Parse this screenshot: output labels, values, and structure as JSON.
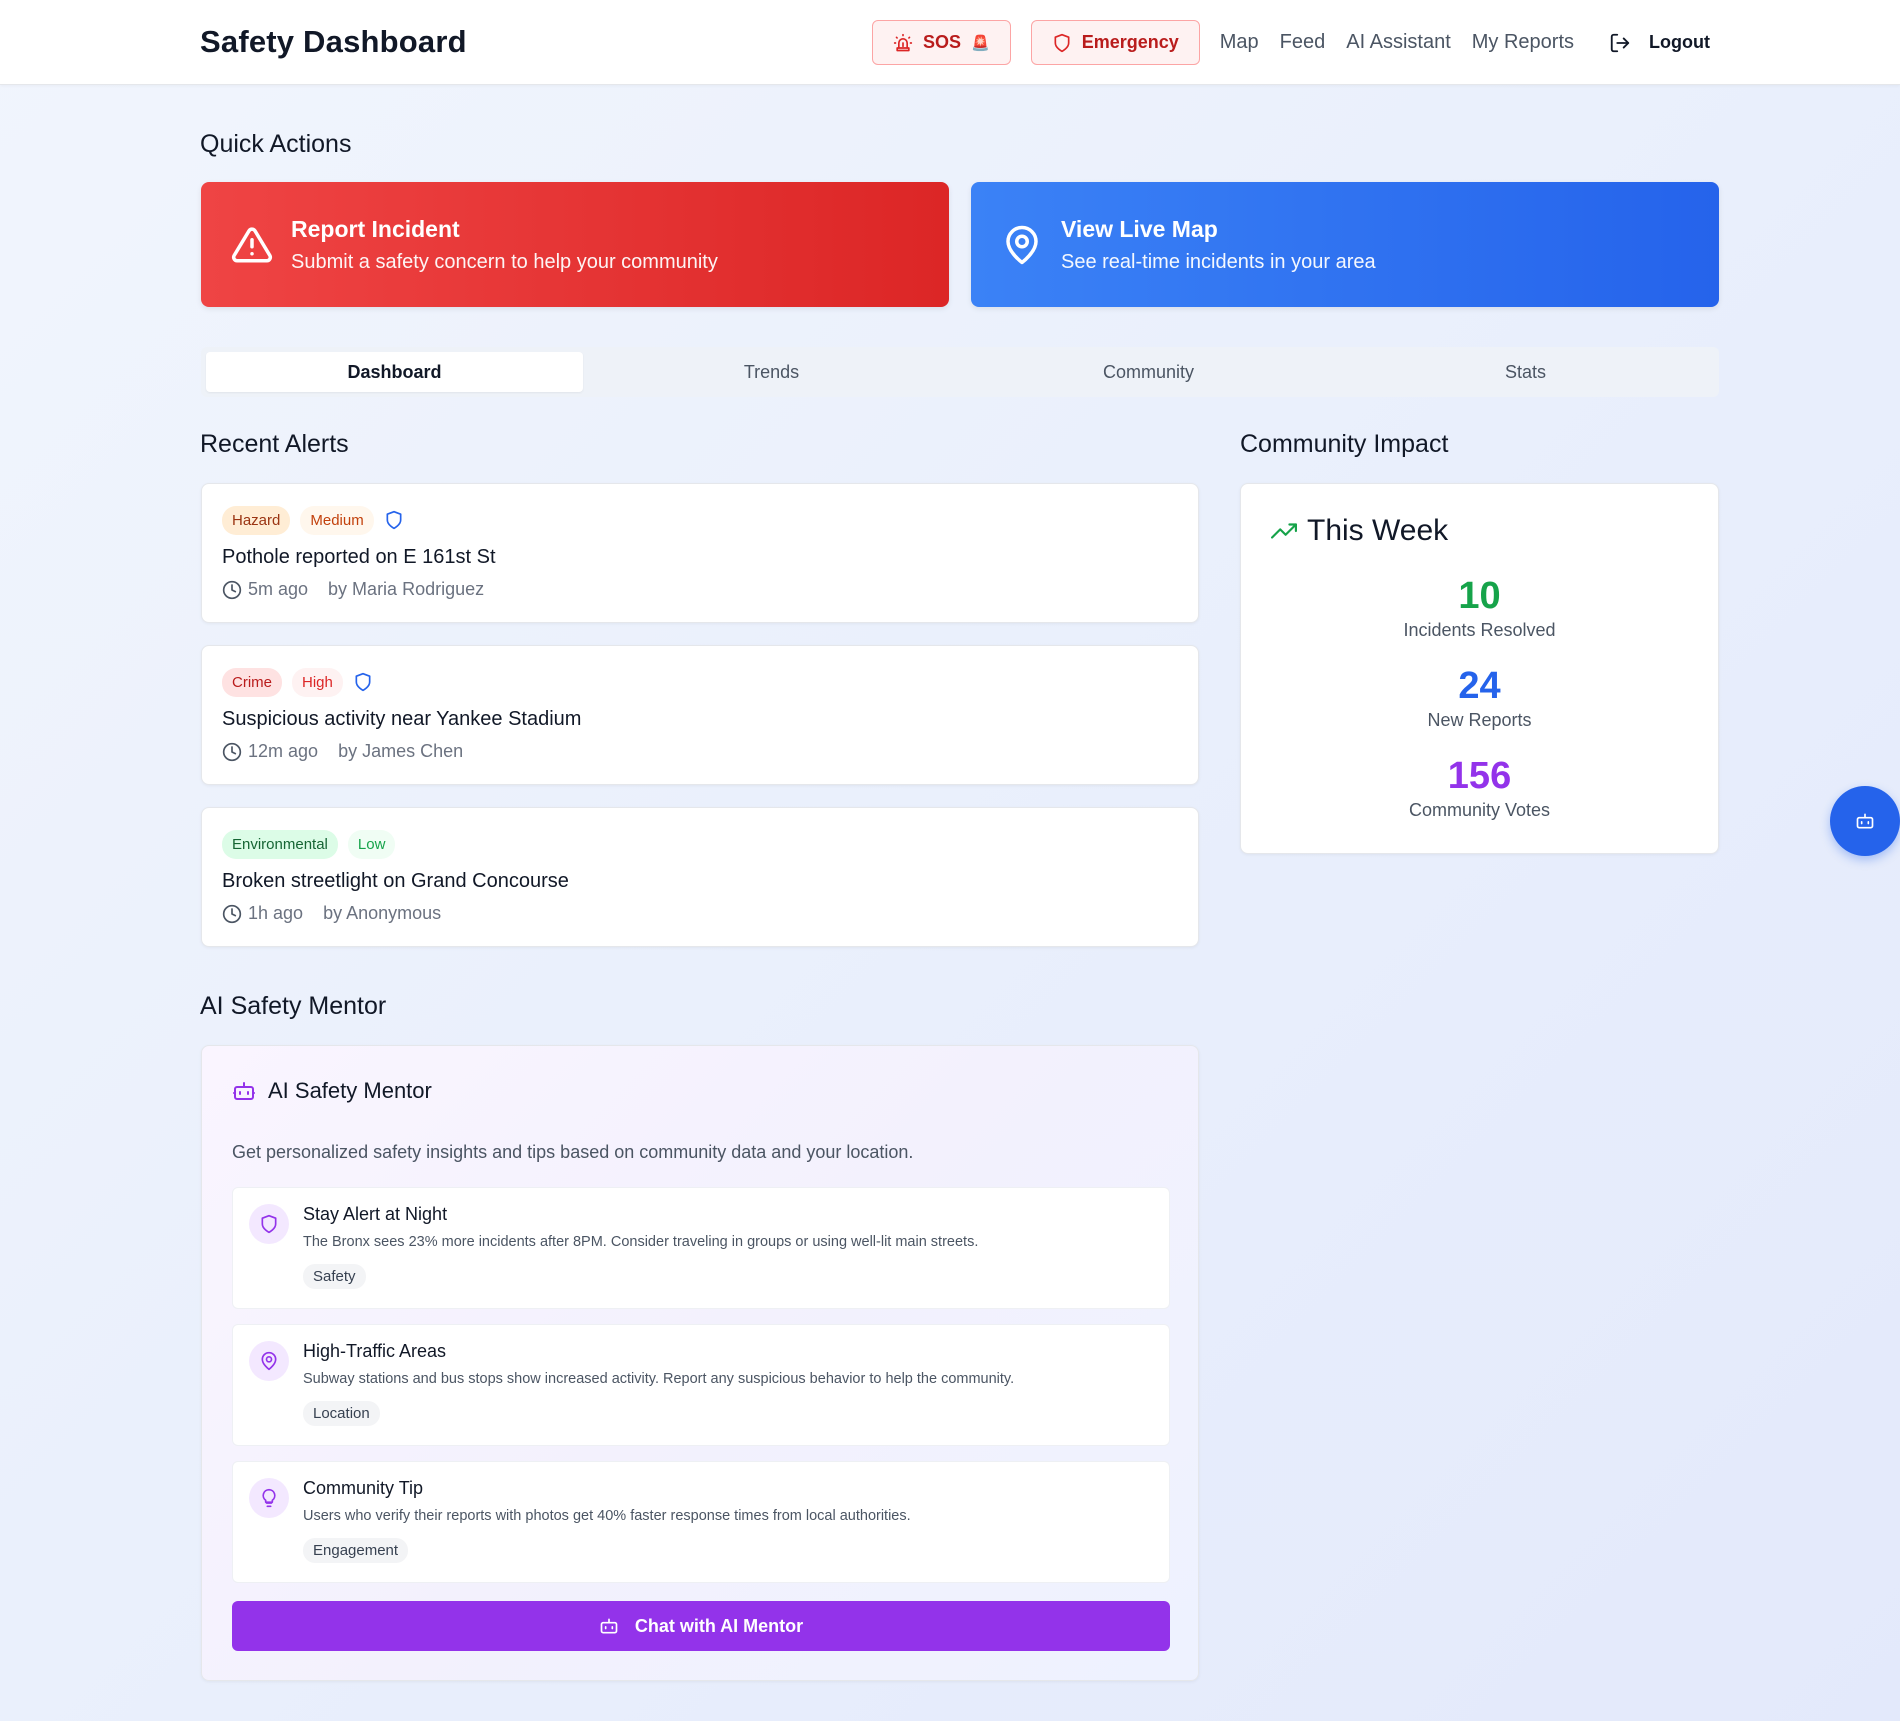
{
  "header": {
    "title": "Safety Dashboard",
    "sos_label": "SOS",
    "sos_emoji": "🚨",
    "emergency_label": "Emergency",
    "nav": [
      "Map",
      "Feed",
      "AI Assistant",
      "My Reports"
    ],
    "logout_label": "Logout",
    "icons": {
      "sos": "siren-icon",
      "emergency": "shield-icon",
      "logout": "logout-icon"
    }
  },
  "quick_actions": {
    "heading": "Quick Actions",
    "report": {
      "title": "Report Incident",
      "subtitle": "Submit a safety concern to help your community",
      "icon": "alert-triangle-icon"
    },
    "map": {
      "title": "View Live Map",
      "subtitle": "See real-time incidents in your area",
      "icon": "map-pin-icon"
    }
  },
  "tabs": [
    {
      "label": "Dashboard",
      "active": true
    },
    {
      "label": "Trends",
      "active": false
    },
    {
      "label": "Community",
      "active": false
    },
    {
      "label": "Stats",
      "active": false
    }
  ],
  "alerts": {
    "heading": "Recent Alerts",
    "items": [
      {
        "category": "Hazard",
        "severity": "Medium",
        "verified": true,
        "title": "Pothole reported on E 161st St",
        "time": "5m ago",
        "author": "by Maria Rodriguez"
      },
      {
        "category": "Crime",
        "severity": "High",
        "verified": true,
        "title": "Suspicious activity near Yankee Stadium",
        "time": "12m ago",
        "author": "by James Chen"
      },
      {
        "category": "Environmental",
        "severity": "Low",
        "verified": false,
        "title": "Broken streetlight on Grand Concourse",
        "time": "1h ago",
        "author": "by Anonymous"
      }
    ]
  },
  "impact": {
    "heading": "Community Impact",
    "title": "This Week",
    "stats": [
      {
        "value": "10",
        "label": "Incidents Resolved",
        "color": "#16a34a"
      },
      {
        "value": "24",
        "label": "New Reports",
        "color": "#2563eb"
      },
      {
        "value": "156",
        "label": "Community Votes",
        "color": "#9333ea"
      }
    ]
  },
  "mentor": {
    "heading": "AI Safety Mentor",
    "title": "AI Safety Mentor",
    "description": "Get personalized safety insights and tips based on community data and your location.",
    "tips": [
      {
        "title": "Stay Alert at Night",
        "text": "The Bronx sees 23% more incidents after 8PM. Consider traveling in groups or using well-lit main streets.",
        "tag": "Safety",
        "icon": "shield-icon"
      },
      {
        "title": "High-Traffic Areas",
        "text": "Subway stations and bus stops show increased activity. Report any suspicious behavior to help the community.",
        "tag": "Location",
        "icon": "map-pin-icon"
      },
      {
        "title": "Community Tip",
        "text": "Users who verify their reports with photos get 40% faster response times from local authorities.",
        "tag": "Engagement",
        "icon": "lightbulb-icon"
      }
    ],
    "button_label": "Chat with AI Mentor"
  },
  "colors": {
    "brand_red": "#dc2626",
    "brand_blue": "#2563eb",
    "brand_purple": "#9333ea"
  }
}
